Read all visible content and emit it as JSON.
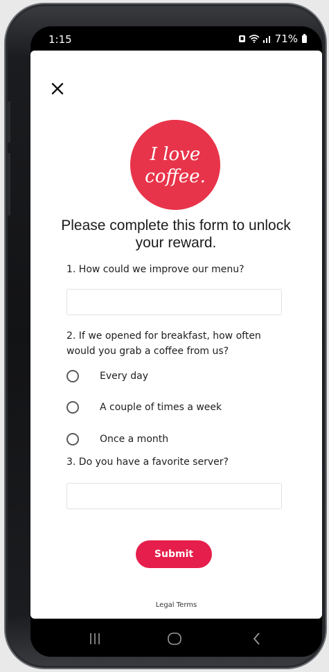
{
  "status_bar": {
    "time": "1:15",
    "battery": "71%"
  },
  "header": {
    "close_icon": "close-icon"
  },
  "logo": {
    "line1": "I love",
    "line2": "coffee.",
    "background": "#e8344a"
  },
  "form": {
    "title": "Please complete this form to unlock your reward.",
    "questions": [
      {
        "label": "1. How could we improve our menu?",
        "type": "text",
        "value": ""
      },
      {
        "label": "2. If we opened for breakfast, how often would you grab a coffee from us?",
        "type": "radio",
        "options": [
          "Every day",
          "A couple of times a week",
          "Once a month"
        ]
      },
      {
        "label": "3. Do you have a favorite server?",
        "type": "text",
        "value": ""
      }
    ],
    "submit_label": "Submit"
  },
  "footer": {
    "legal_link": "Legal Terms"
  },
  "colors": {
    "accent": "#e61e4b",
    "text": "#1d1d1d"
  }
}
